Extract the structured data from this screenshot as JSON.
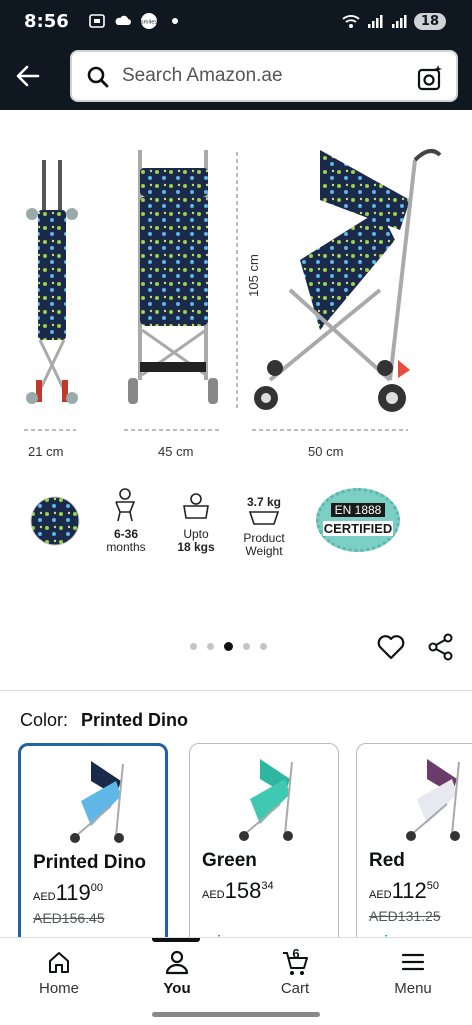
{
  "status_bar": {
    "time": "8:56",
    "left_icons": [
      "screenshot-icon",
      "cloud-icon",
      "smiles-icon",
      "dot-icon"
    ],
    "smiles_label": "smiles",
    "right_icons": [
      "wifi-icon",
      "signal-icon",
      "signal-r-icon"
    ],
    "battery": "18"
  },
  "header": {
    "back_icon": "back-arrow-icon",
    "search_placeholder": "Search Amazon.ae",
    "camera_icon": "camera-lens-icon"
  },
  "gallery": {
    "dimension_labels": [
      "21 cm",
      "45 cm",
      "50 cm"
    ],
    "height_label": "105 cm",
    "features": [
      {
        "line1": "6-36",
        "line2": "months"
      },
      {
        "line1": "Upto",
        "line2": "18 kgs"
      },
      {
        "line1": "3.7 kg",
        "line2": "Product",
        "line3": "Weight"
      }
    ],
    "badge": {
      "line1": "EN 1888",
      "line2": "CERTIFIED"
    },
    "dots_total": 5,
    "active_dot": 2
  },
  "color_selector": {
    "label": "Color:",
    "value": "Printed Dino"
  },
  "variants": [
    {
      "name": "Printed Dino",
      "currency": "AED",
      "price_whole": "119",
      "price_frac": "00",
      "old_price": "AED156.45",
      "selected": true,
      "prime": "prime"
    },
    {
      "name": "Green",
      "currency": "AED",
      "price_whole": "158",
      "price_frac": "34",
      "old_price": "",
      "selected": false,
      "prime": "prime"
    },
    {
      "name": "Red",
      "currency": "AED",
      "price_whole": "112",
      "price_frac": "50",
      "old_price": "AED131.25",
      "selected": false,
      "prime": "prime"
    }
  ],
  "bottom_nav": {
    "home": "Home",
    "you": "You",
    "cart": "Cart",
    "cart_count": "6",
    "menu": "Menu",
    "active": "You"
  },
  "colors": {
    "header_bg": "#0f1720",
    "selected_border": "#2162a1",
    "prime_blue": "#00a8e1",
    "badge_teal": "#7ccfc4"
  }
}
